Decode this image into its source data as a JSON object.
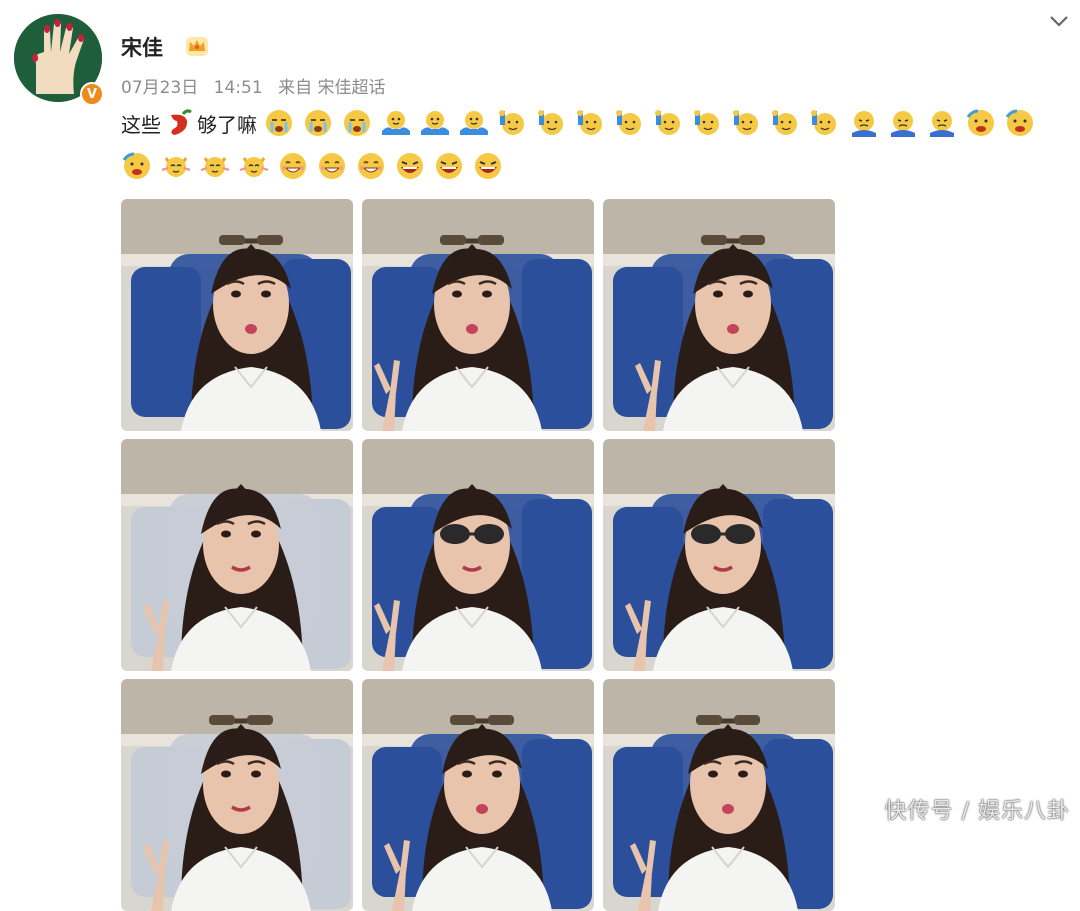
{
  "user": {
    "name": "宋佳",
    "verified_badge": "V",
    "avatar_icon": "hand-painted-nails-icon",
    "crown_icon": "crown-icon"
  },
  "meta": {
    "date": "07月23日",
    "time": "14:51",
    "source": "来自 宋佳超话"
  },
  "post": {
    "text_part1": "这些",
    "text_part2": "够了嘛"
  },
  "watermark": "快传号 / 娱乐八卦",
  "colors": {
    "seat_blue": "#2b4f9b",
    "shirt_white": "#f4f4f2",
    "hair_dark": "#2a1c16",
    "skin": "#e9c4ad",
    "cabin_light": "#d9d6cf"
  }
}
